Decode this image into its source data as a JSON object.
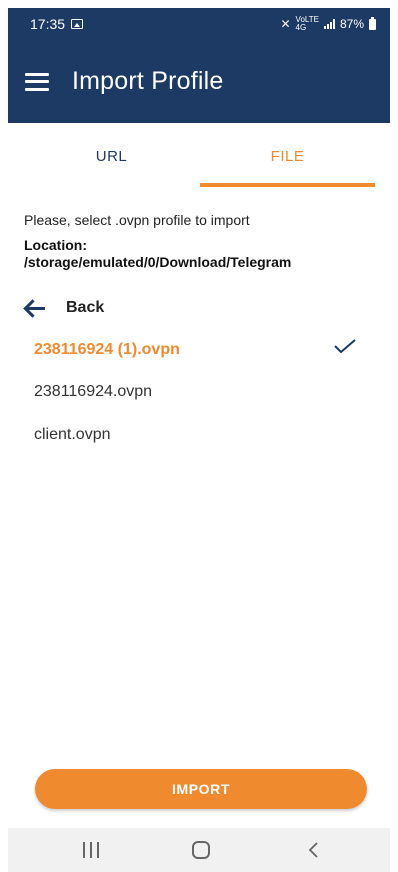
{
  "status_bar": {
    "time": "17:35",
    "network_top": "VoLTE",
    "network_bottom": "4G",
    "battery": "87%"
  },
  "app_bar": {
    "title": "Import Profile"
  },
  "tabs": [
    {
      "label": "URL",
      "selected": false
    },
    {
      "label": "FILE",
      "selected": true
    }
  ],
  "content": {
    "prompt": "Please, select .ovpn profile to import",
    "location": "Location: /storage/emulated/0/Download/Telegram",
    "back_label": "Back",
    "files": [
      {
        "name": "238116924 (1).ovpn",
        "selected": true
      },
      {
        "name": "238116924.ovpn",
        "selected": false
      },
      {
        "name": "client.ovpn",
        "selected": false
      }
    ]
  },
  "import_button": {
    "label": "IMPORT"
  },
  "colors": {
    "primary": "#1c3a63",
    "accent": "#ef8a2f"
  },
  "icons": {
    "menu": "menu-icon",
    "back": "back-arrow-icon",
    "check": "check-icon"
  }
}
